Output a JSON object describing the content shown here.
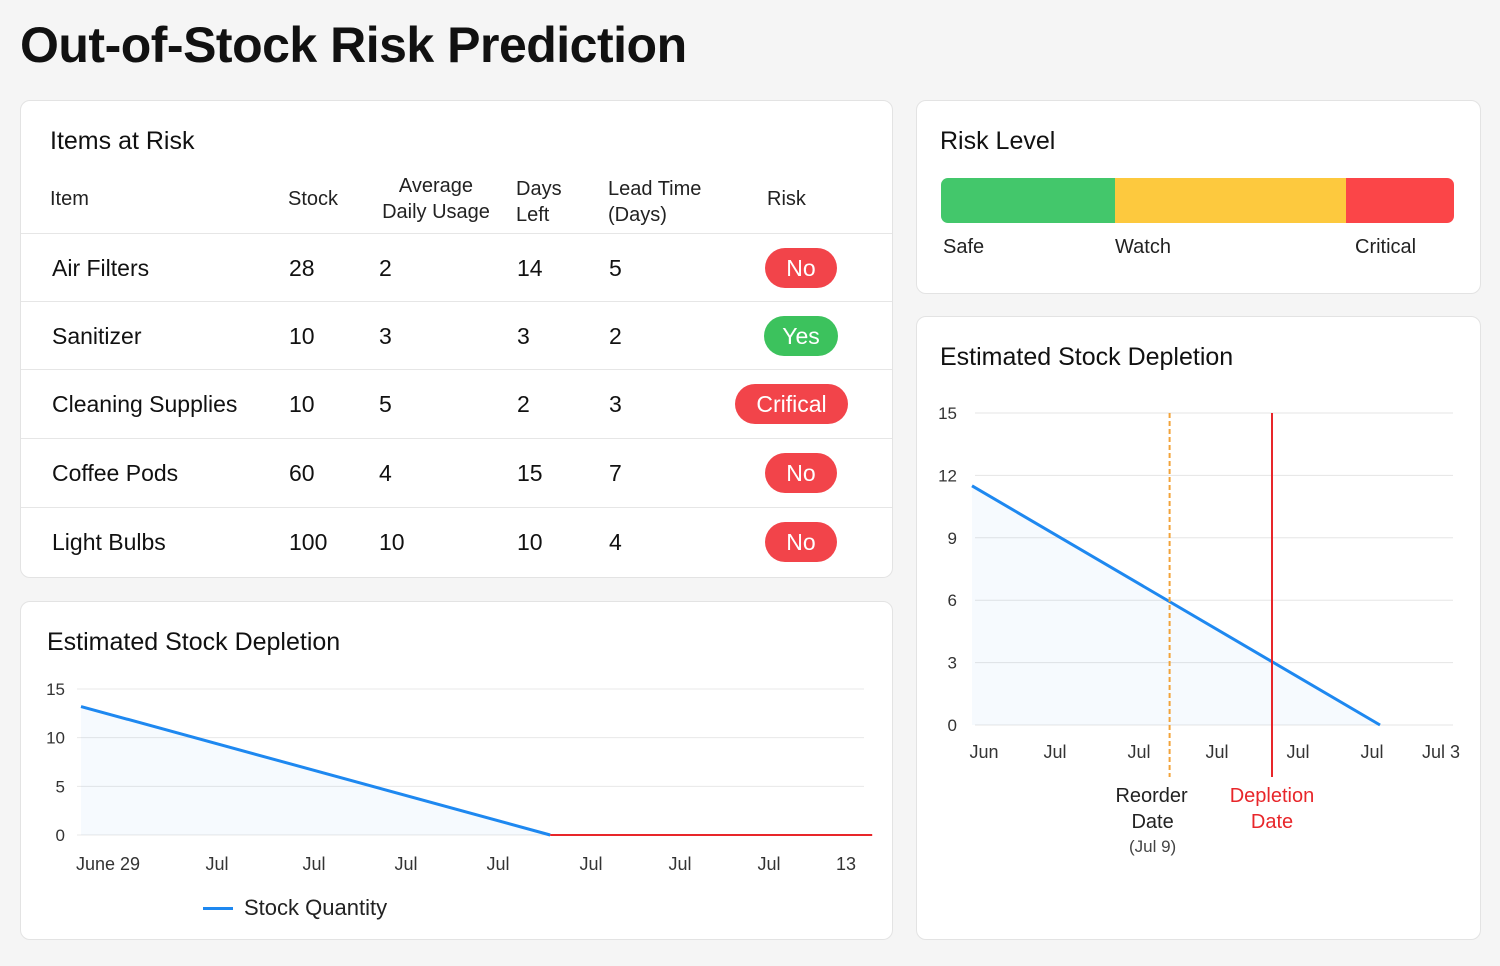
{
  "page": {
    "title": "Out-of-Stock Risk Prediction"
  },
  "items_table": {
    "title": "Items at Risk",
    "headers": {
      "item": "Item",
      "stock": "Stock",
      "avg_usage_1": "Average",
      "avg_usage_2": "Daily Usage",
      "days_left_1": "Days",
      "days_left_2": "Left",
      "lead_time_1": "Lead Time",
      "lead_time_2": "(Days)",
      "risk": "Risk"
    },
    "rows": [
      {
        "item": "Air Filters",
        "stock": "28",
        "avg_usage": "2",
        "days_left": "14",
        "lead_time": "5",
        "risk": "No",
        "risk_color": "#f2444a"
      },
      {
        "item": "Sanitizer",
        "stock": "10",
        "avg_usage": "3",
        "days_left": "3",
        "lead_time": "2",
        "risk": "Yes",
        "risk_color": "#3cc25d"
      },
      {
        "item": "Cleaning Supplies",
        "stock": "10",
        "avg_usage": "5",
        "days_left": "2",
        "lead_time": "3",
        "risk": "Crifical",
        "risk_color": "#f2444a"
      },
      {
        "item": "Coffee Pods",
        "stock": "60",
        "avg_usage": "4",
        "days_left": "15",
        "lead_time": "7",
        "risk": "No",
        "risk_color": "#f2444a"
      },
      {
        "item": "Light Bulbs",
        "stock": "100",
        "avg_usage": "10",
        "days_left": "10",
        "lead_time": "4",
        "risk": "No",
        "risk_color": "#f2444a"
      }
    ]
  },
  "risk_level": {
    "title": "Risk Level",
    "segments": [
      {
        "label": "Safe",
        "color": "#43c76b",
        "share": 0.34
      },
      {
        "label": "Watch",
        "color": "#fdc93e",
        "share": 0.45
      },
      {
        "label": "Critical",
        "color": "#fb4548",
        "share": 0.21
      }
    ]
  },
  "chart_data": [
    {
      "type": "line",
      "title": "Estimated Stock Depletion",
      "x_ticks": [
        "Jun",
        "Jul",
        "Jul",
        "Jul",
        "Jul",
        "Jul",
        "Jul 3"
      ],
      "y_ticks": [
        0,
        3,
        6,
        9,
        12,
        15
      ],
      "ylim": [
        0,
        15
      ],
      "grid": true,
      "series": [
        {
          "x": [
            0,
            5.1
          ],
          "values": [
            11.5,
            0
          ],
          "color": "#1e88f0"
        }
      ],
      "markers": [
        {
          "x": 2.47,
          "label_1": "Reorder",
          "label_2": "Date",
          "label_3": "(Jul 9)",
          "color": "#f2a33a",
          "style": "dashed"
        },
        {
          "x": 3.75,
          "label_1": "Depletion",
          "label_2": "Date",
          "label_3": "",
          "color": "#e8262a",
          "style": "solid"
        }
      ]
    },
    {
      "type": "line",
      "title": "Estimated Stock Depletion",
      "x_ticks": [
        "June 29",
        "Jul",
        "Jul",
        "Jul",
        "Jul",
        "Jul",
        "Jul",
        "Jul",
        "13"
      ],
      "y_ticks": [
        0,
        5,
        10,
        15
      ],
      "ylim": [
        0,
        15
      ],
      "grid": true,
      "series": [
        {
          "name": "Stock Quantity",
          "x": [
            0,
            5.1
          ],
          "values": [
            13.2,
            0
          ],
          "color": "#1e88f0"
        },
        {
          "x": [
            5.1,
            8.6
          ],
          "values": [
            0,
            0
          ],
          "color": "#e8262a"
        }
      ],
      "legend": "bottom-left"
    }
  ]
}
